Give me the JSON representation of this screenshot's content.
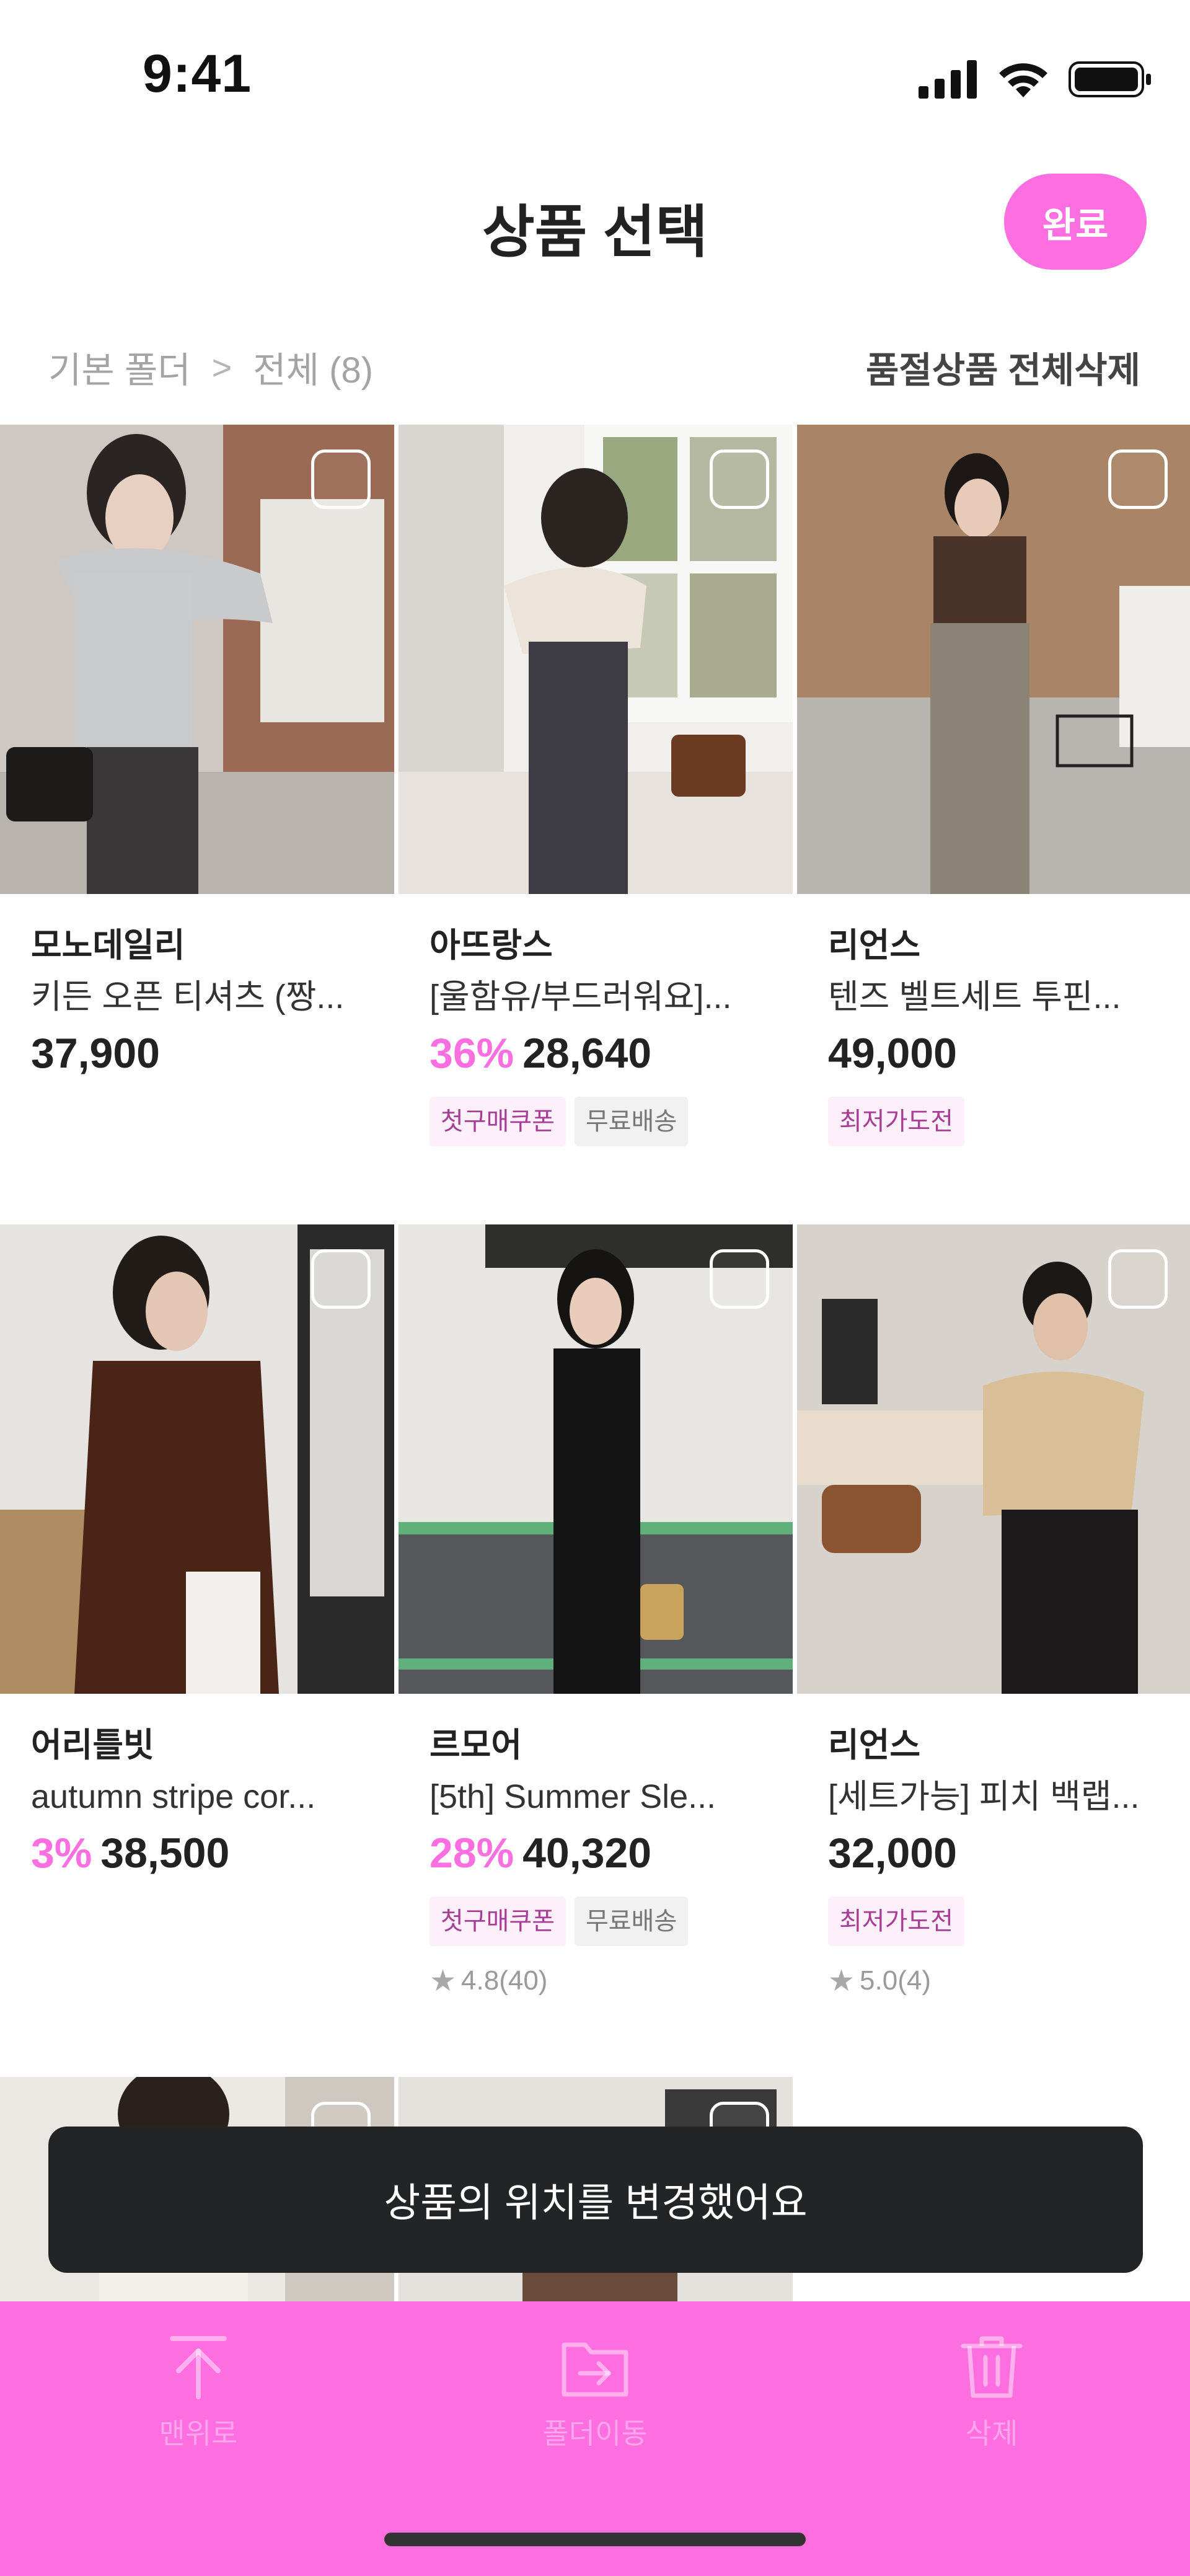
{
  "status_bar": {
    "time": "9:41"
  },
  "header": {
    "title": "상품 선택",
    "done_label": "완료"
  },
  "breadcrumb": {
    "root": "기본 폴더",
    "separator": ">",
    "current": "전체 (8)"
  },
  "delete_soldout_label": "품절상품 전체삭제",
  "products": [
    {
      "brand": "모노데일리",
      "name": "키든 오픈 티셔츠 (짱...",
      "discount": "",
      "price": "37,900",
      "tags": [],
      "rating": ""
    },
    {
      "brand": "아뜨랑스",
      "name": "[울함유/부드러워요]...",
      "discount": "36%",
      "price": "28,640",
      "tags": [
        "첫구매쿠폰",
        "무료배송"
      ],
      "rating": ""
    },
    {
      "brand": "리언스",
      "name": "텐즈 벨트세트 투핀...",
      "discount": "",
      "price": "49,000",
      "tags": [
        "최저가도전"
      ],
      "rating": ""
    },
    {
      "brand": "어리틀빗",
      "name": "autumn stripe cor...",
      "discount": "3%",
      "price": "38,500",
      "tags": [],
      "rating": ""
    },
    {
      "brand": "르모어",
      "name": "[5th] Summer Sle...",
      "discount": "28%",
      "price": "40,320",
      "tags": [
        "첫구매쿠폰",
        "무료배송"
      ],
      "rating": "4.8(40)"
    },
    {
      "brand": "리언스",
      "name": "[세트가능] 피치 백랩...",
      "discount": "",
      "price": "32,000",
      "tags": [
        "최저가도전"
      ],
      "rating": "5.0(4)"
    }
  ],
  "toast": {
    "message": "상품의 위치를 변경했어요"
  },
  "toolbar": {
    "items": [
      {
        "label": "맨위로",
        "icon": "arrow-up-to-top-icon"
      },
      {
        "label": "폴더이동",
        "icon": "folder-move-icon"
      },
      {
        "label": "삭제",
        "icon": "trash-icon"
      }
    ]
  },
  "colors": {
    "accent": "#fd6ee0",
    "toast_bg": "#222426",
    "tag_pink_bg": "#fdf0fb",
    "tag_pink_text": "#a83d95"
  }
}
